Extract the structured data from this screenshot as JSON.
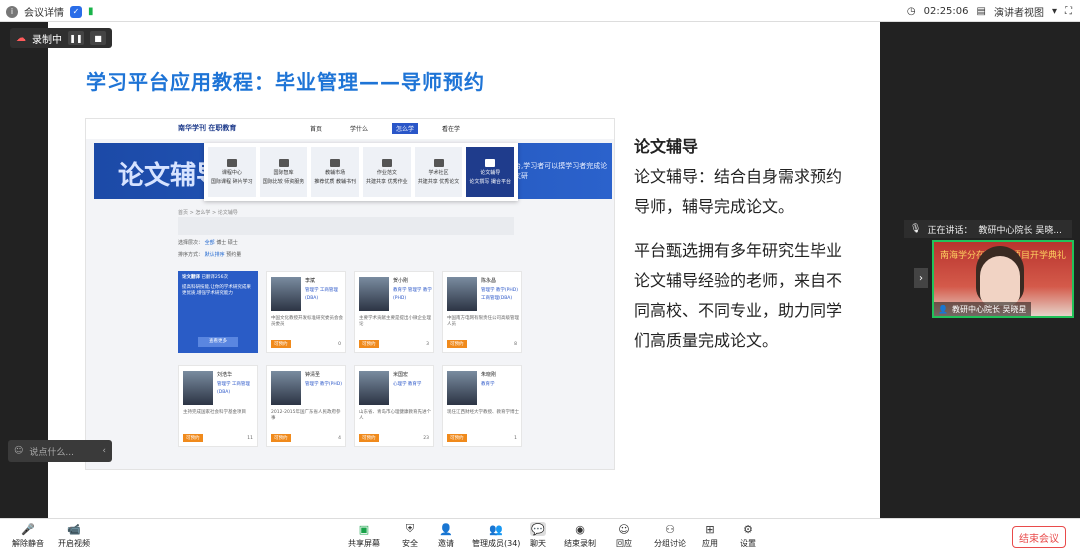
{
  "topbar": {
    "meeting_details": "会议详情",
    "time": "02:25:06",
    "view_mode": "演讲者视图"
  },
  "recording": {
    "label": "录制中"
  },
  "slide": {
    "title": "学习平台应用教程：毕业管理——导师预约",
    "heading": "论文辅导",
    "para1": "论文辅导：结合自身需求预约导师，辅导完成论文。",
    "para2": "平台甄选拥有多年研究生毕业论文辅导经验的老师，来自不同高校、不同专业，助力同学们高质量完成论文。"
  },
  "web": {
    "logo": "南华学刊 在职教育",
    "nav": [
      "首页",
      "学什么",
      "怎么学",
      "看在学"
    ],
    "nav_active_index": 2,
    "banner_big": "论文辅导",
    "banner_text": "台,学习者可以摸学习者完成论文研",
    "dropdown": [
      {
        "title": "课程中心",
        "sub": "国际课程 碎片学习"
      },
      {
        "title": "国际智库",
        "sub": "国际比较 师资服务"
      },
      {
        "title": "教辅市场",
        "sub": "推荐优质 教辅书刊"
      },
      {
        "title": "作业范文",
        "sub": "共建共享 优秀作业"
      },
      {
        "title": "学术社区",
        "sub": "共建共享 优秀论文"
      },
      {
        "title": "论文辅导",
        "sub": "论文撰写 撮合平台"
      }
    ],
    "breadcrumb": "首页 > 怎么学 > 论文辅导",
    "filter_level": "选择层次：",
    "filter_all": "全部",
    "filter_opts": "博士  硕士",
    "sort_label": "排序方式：",
    "sort_default": "默认排序",
    "sort_reserved": "预约量",
    "intro": {
      "title": "论文翻译",
      "count": "已翻译256次",
      "body": "提高科研技能,让你的学术研究成果更优质,增强学术研究能力",
      "more": "查看更多"
    },
    "tutors": [
      {
        "name": "李斌",
        "tags": "管理学 工商管理(DBA)",
        "desc": "中国文化教授开发标准研究委员会会员委员",
        "count": "0"
      },
      {
        "name": "贺小刚",
        "tags": "教育学 管理学 教学(PHD)",
        "desc": "主要学术贡献主要是提出小微企业理论",
        "count": "3"
      },
      {
        "name": "陈永昌",
        "tags": "管理学 教学(PHD) 工商管理(DBA)",
        "desc": "中国南方电网有限责任公司高级管理人员",
        "count": "8"
      },
      {
        "name": "刘浩华",
        "tags": "管理学 工商管理(DBA)",
        "desc": "主持完成国家社会科学基金项目",
        "count": "11"
      },
      {
        "name": "钟清圣",
        "tags": "管理学 教学(PHD)",
        "desc": "2012-2015年国广东省人民政府参事",
        "count": "4"
      },
      {
        "name": "米国宏",
        "tags": "心理学 教育学",
        "desc": "山东省、青岛市心理健康教育先进个人",
        "count": "23"
      },
      {
        "name": "朱晓刚",
        "tags": "教育学",
        "desc": "现任江西财经大学教授、教育学博士",
        "count": "1"
      }
    ],
    "reserve_label": "可预约"
  },
  "chat": {
    "placeholder": "说点什么..."
  },
  "speaker": {
    "speaking": "正在讲话：",
    "name": "教研中心院长 吴晓...",
    "video_banner": "南海学分在职学位项目开学典礼",
    "video_label": "教研中心院长 吴晓星"
  },
  "toolbar": {
    "mute": "解除静音",
    "video": "开启视频",
    "share": "共享屏幕",
    "security": "安全",
    "invite": "邀请",
    "members": "管理成员(34)",
    "chat": "聊天",
    "end_record": "结束录制",
    "reaction": "回应",
    "breakout": "分组讨论",
    "apps": "应用",
    "settings": "设置",
    "end_meeting": "结束会议"
  }
}
